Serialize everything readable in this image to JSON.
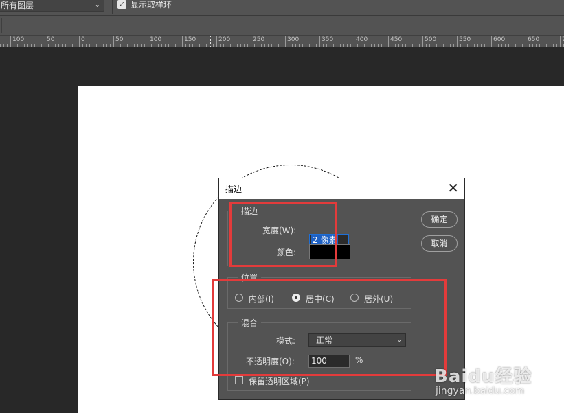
{
  "toolbar": {
    "layer_select": "所有图层",
    "show_sampling_ring_label": "显示取样环",
    "show_sampling_ring_checked": true
  },
  "ruler": {
    "labels": [
      "100",
      "50",
      "0",
      "50",
      "100",
      "150",
      "200",
      "250",
      "300",
      "350",
      "400",
      "450",
      "500",
      "550",
      "600",
      "650",
      "7"
    ]
  },
  "dialog": {
    "title": "描边",
    "stroke_group": {
      "title": "描边",
      "width_label": "宽度(W):",
      "width_value": "2 像素",
      "color_label": "颜色:",
      "color_value": "#000000"
    },
    "position_group": {
      "title": "位置",
      "options": [
        {
          "label": "内部(I)",
          "selected": false
        },
        {
          "label": "居中(C)",
          "selected": true
        },
        {
          "label": "居外(U)",
          "selected": false
        }
      ]
    },
    "blend_group": {
      "title": "混合",
      "mode_label": "模式:",
      "mode_value": "正常",
      "opacity_label": "不透明度(O):",
      "opacity_value": "100",
      "opacity_unit": "%"
    },
    "preserve_transparency_label": "保留透明区域(P)",
    "ok_label": "确定",
    "cancel_label": "取消"
  },
  "colors": {
    "highlight": "#e33b3b",
    "panel": "#535353",
    "canvas": "#ffffff"
  },
  "watermark": {
    "brand": "Baidu经验",
    "url": "jingyan.baidu.com"
  }
}
